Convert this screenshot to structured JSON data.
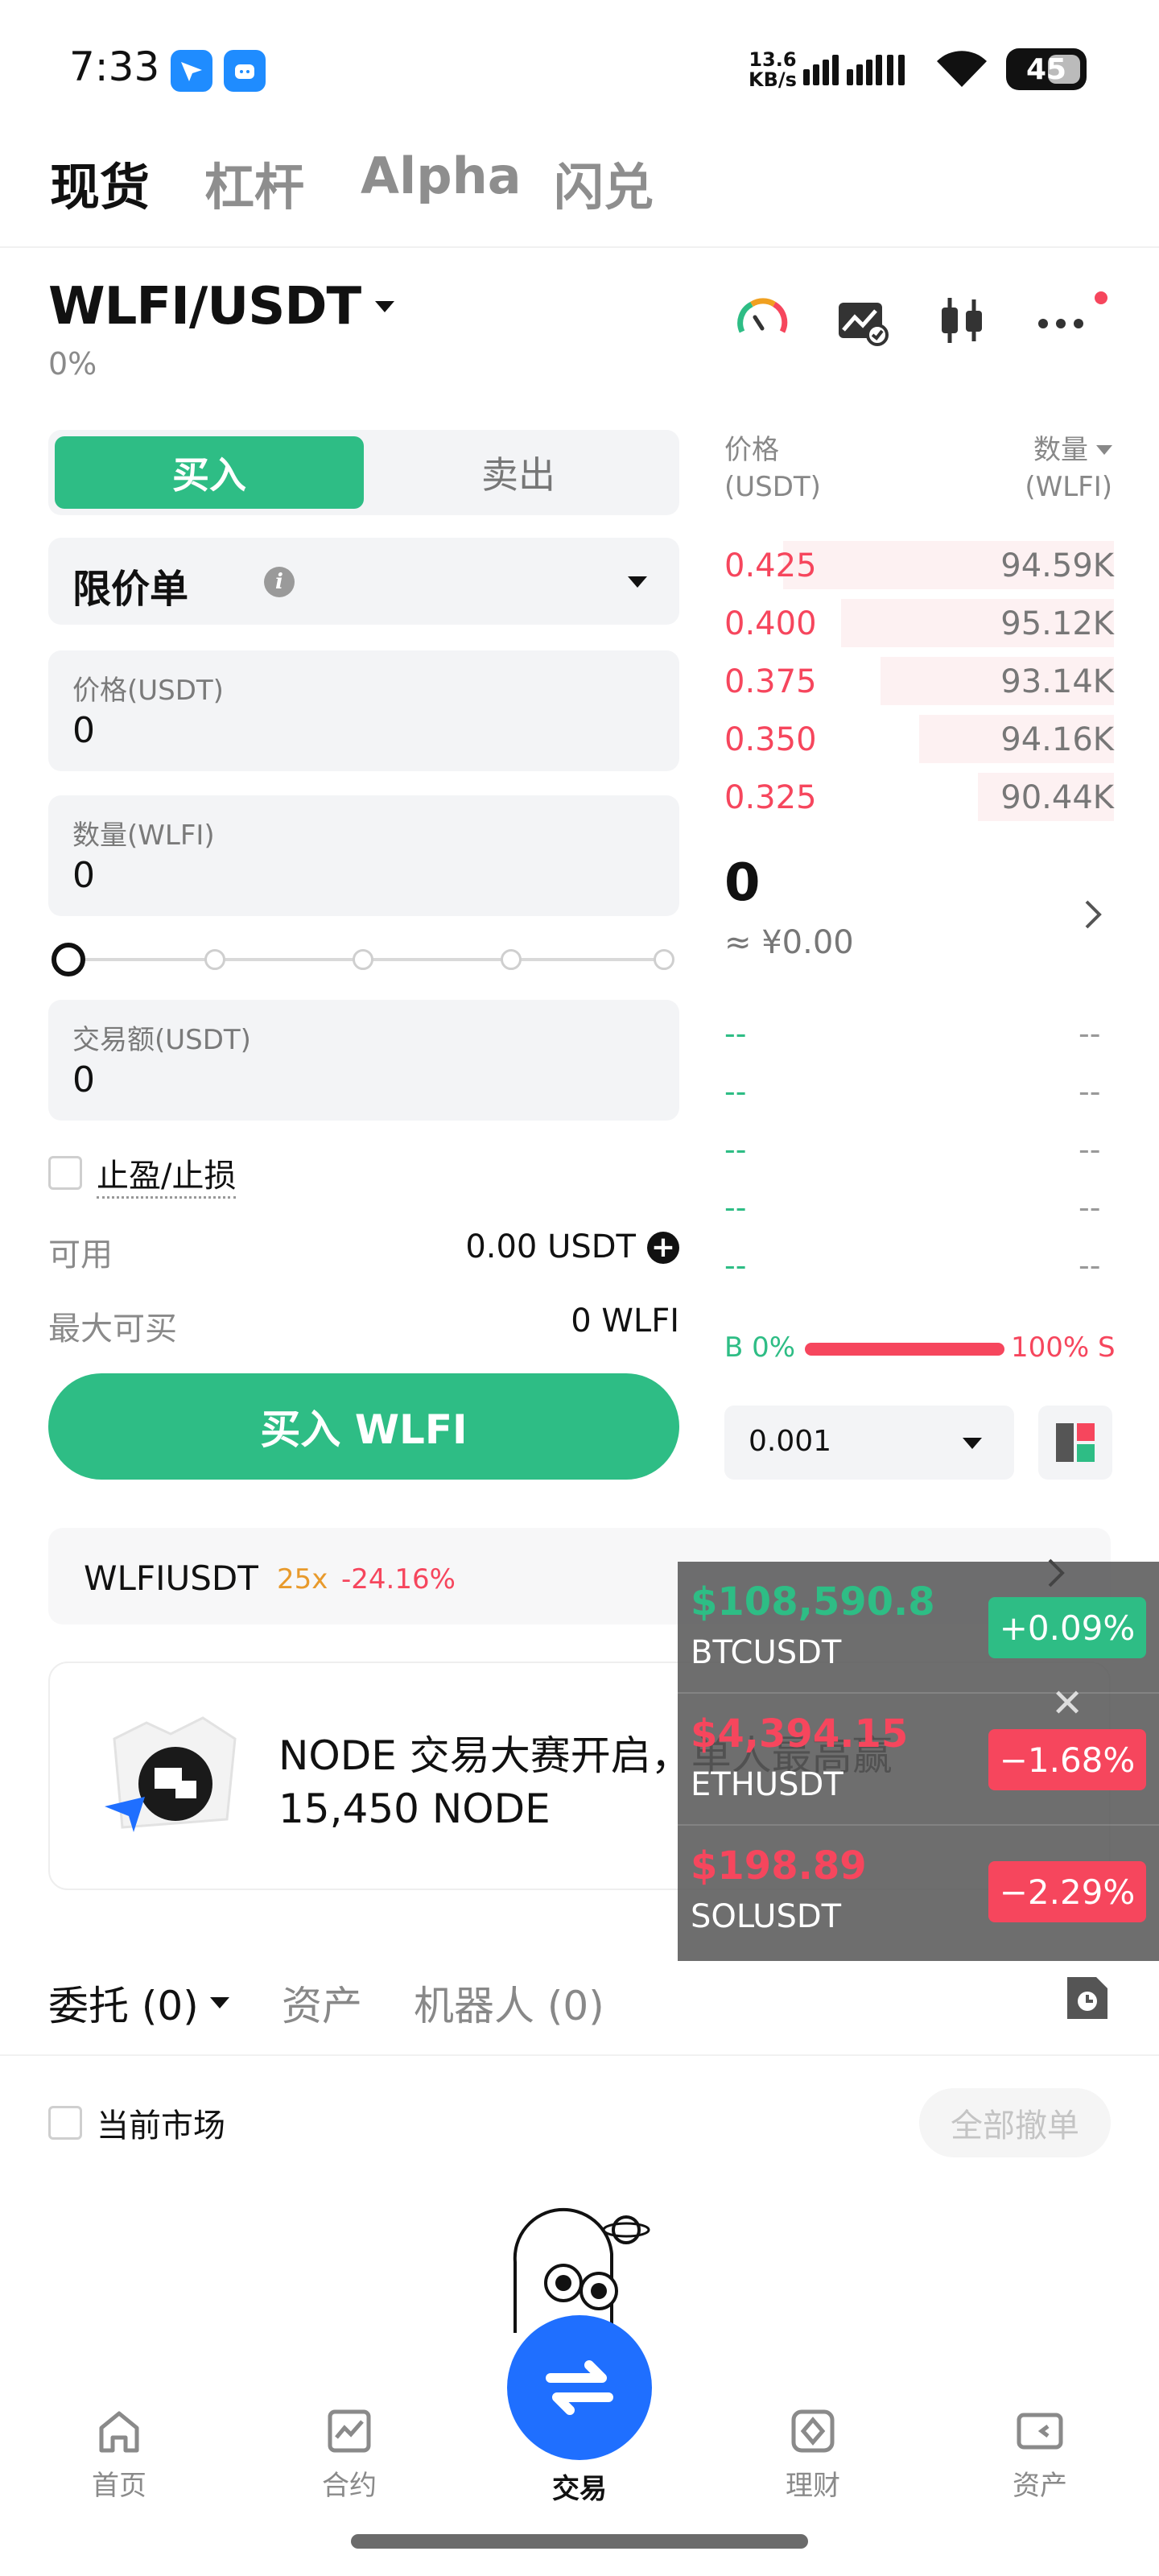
{
  "status_bar": {
    "time": "7:33",
    "net_speed_value": "13.6",
    "net_speed_unit": "KB/s",
    "battery": "45"
  },
  "top_tabs": [
    "现货",
    "杠杆",
    "Alpha",
    "闪兑"
  ],
  "pair": {
    "symbol": "WLFI/USDT",
    "change": "0%"
  },
  "order_form": {
    "buy_label": "买入",
    "sell_label": "卖出",
    "order_type": "限价单",
    "price_label": "价格(USDT)",
    "price_value": "0",
    "qty_label": "数量(WLFI)",
    "qty_value": "0",
    "amount_label": "交易额(USDT)",
    "amount_value": "0",
    "tpsl_label": "止盈/止损",
    "available_label": "可用",
    "available_value": "0.00 USDT",
    "maxbuy_label": "最大可买",
    "maxbuy_value": "0 WLFI",
    "submit_label": "买入 WLFI",
    "slider_position": 0
  },
  "orderbook": {
    "price_header": "价格",
    "price_unit": "(USDT)",
    "qty_header": "数量",
    "qty_unit": "(WLFI)",
    "asks": [
      {
        "price": "0.425",
        "qty": "94.59K",
        "depth": 0.85
      },
      {
        "price": "0.400",
        "qty": "95.12K",
        "depth": 0.7
      },
      {
        "price": "0.375",
        "qty": "93.14K",
        "depth": 0.6
      },
      {
        "price": "0.350",
        "qty": "94.16K",
        "depth": 0.5
      },
      {
        "price": "0.325",
        "qty": "90.44K",
        "depth": 0.35
      }
    ],
    "last_price": "0",
    "last_price_cny": "≈ ¥0.00",
    "bids": [
      {
        "price": "--",
        "qty": "--"
      },
      {
        "price": "--",
        "qty": "--"
      },
      {
        "price": "--",
        "qty": "--"
      },
      {
        "price": "--",
        "qty": "--"
      },
      {
        "price": "--",
        "qty": "--"
      }
    ],
    "buy_ratio": "B 0%",
    "sell_ratio": "100% S",
    "depth_step": "0.001"
  },
  "contract_bar": {
    "symbol": "WLFIUSDT",
    "leverage": "25x",
    "change": "-24.16%"
  },
  "promo": {
    "line1": "NODE 交易大赛开启，单人最高赢",
    "line2": "15,450 NODE"
  },
  "ticker": [
    {
      "price": "$108,590.8",
      "symbol": "BTCUSDT",
      "change": "+0.09%",
      "color": "#2ebd85"
    },
    {
      "price": "$4,394.15",
      "symbol": "ETHUSDT",
      "change": "−1.68%",
      "color": "#f6465d"
    },
    {
      "price": "$198.89",
      "symbol": "SOLUSDT",
      "change": "−2.29%",
      "color": "#f6465d"
    }
  ],
  "order_tabs": {
    "orders": "委托 (0)",
    "assets": "资产",
    "bots": "机器人 (0)"
  },
  "current_market_label": "当前市场",
  "cancel_all_label": "全部撤单",
  "bottom_nav": {
    "home": "首页",
    "futures": "合约",
    "trade": "交易",
    "earn": "理财",
    "assets": "资产"
  },
  "colors": {
    "green": "#2ebd85",
    "red": "#f6465d",
    "fab_blue": "#1f6fff"
  }
}
